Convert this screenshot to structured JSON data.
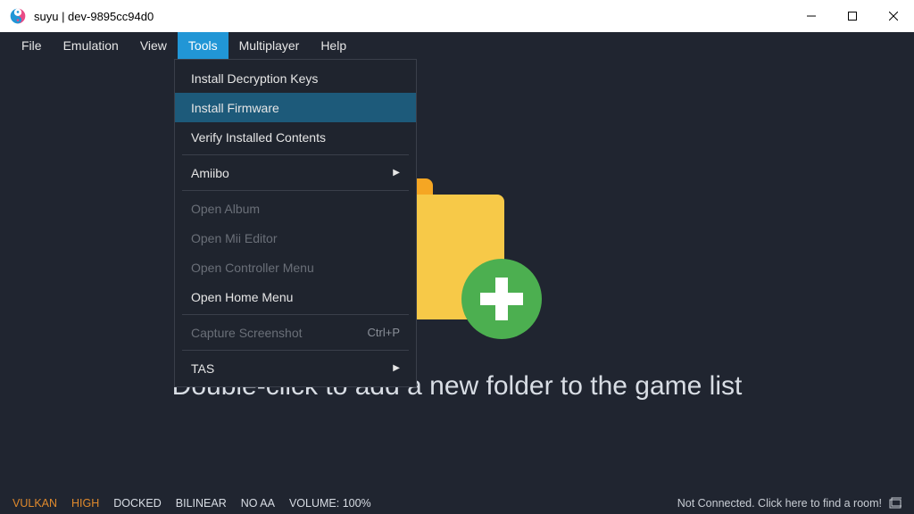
{
  "titlebar": {
    "title": "suyu | dev-9895cc94d0"
  },
  "menubar": {
    "items": [
      {
        "label": "File"
      },
      {
        "label": "Emulation"
      },
      {
        "label": "View"
      },
      {
        "label": "Tools",
        "active": true
      },
      {
        "label": "Multiplayer"
      },
      {
        "label": "Help"
      }
    ]
  },
  "tools_dropdown": {
    "install_keys": "Install Decryption Keys",
    "install_firmware": "Install Firmware",
    "verify_contents": "Verify Installed Contents",
    "amiibo": "Amiibo",
    "open_album": "Open Album",
    "open_mii": "Open Mii Editor",
    "open_controller": "Open Controller Menu",
    "open_home": "Open Home Menu",
    "capture_screenshot": "Capture Screenshot",
    "capture_shortcut": "Ctrl+P",
    "tas": "TAS"
  },
  "main": {
    "hint": "Double-click to add a new folder to the game list"
  },
  "statusbar": {
    "api": "VULKAN",
    "accuracy": "HIGH",
    "dock": "DOCKED",
    "filter": "BILINEAR",
    "aa": "NO AA",
    "volume": "VOLUME: 100%",
    "connection": "Not Connected. Click here to find a room!"
  }
}
